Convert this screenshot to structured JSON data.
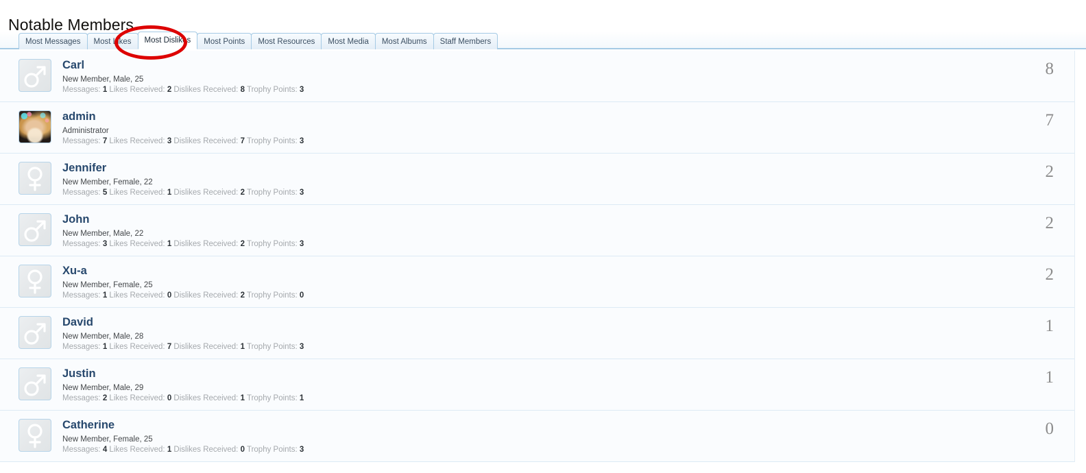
{
  "page": {
    "title": "Notable Members"
  },
  "tabs": [
    {
      "label": "Most Messages",
      "active": false
    },
    {
      "label": "Most Likes",
      "active": false
    },
    {
      "label": "Most Dislikes",
      "active": true
    },
    {
      "label": "Most Points",
      "active": false
    },
    {
      "label": "Most Resources",
      "active": false
    },
    {
      "label": "Most Media",
      "active": false
    },
    {
      "label": "Most Albums",
      "active": false
    },
    {
      "label": "Staff Members",
      "active": false
    }
  ],
  "stat_labels": {
    "messages": "Messages:",
    "likes": "Likes Received:",
    "dislikes": "Dislikes Received:",
    "trophy": "Trophy Points:"
  },
  "members": [
    {
      "name": "Carl",
      "avatar": "male-symbol-avatar",
      "meta": "New Member, Male, 25",
      "messages": "1",
      "likes": "2",
      "dislikes": "8",
      "trophy": "3",
      "count": "8"
    },
    {
      "name": "admin",
      "avatar": "photo-avatar",
      "meta": "Administrator",
      "messages": "7",
      "likes": "3",
      "dislikes": "7",
      "trophy": "3",
      "count": "7"
    },
    {
      "name": "Jennifer",
      "avatar": "female-symbol-avatar",
      "meta": "New Member, Female, 22",
      "messages": "5",
      "likes": "1",
      "dislikes": "2",
      "trophy": "3",
      "count": "2"
    },
    {
      "name": "John",
      "avatar": "male-symbol-avatar",
      "meta": "New Member, Male, 22",
      "messages": "3",
      "likes": "1",
      "dislikes": "2",
      "trophy": "3",
      "count": "2"
    },
    {
      "name": "Xu-a",
      "avatar": "female-symbol-avatar",
      "meta": "New Member, Female, 25",
      "messages": "1",
      "likes": "0",
      "dislikes": "2",
      "trophy": "0",
      "count": "2"
    },
    {
      "name": "David",
      "avatar": "male-symbol-avatar",
      "meta": "New Member, Male, 28",
      "messages": "1",
      "likes": "7",
      "dislikes": "1",
      "trophy": "3",
      "count": "1"
    },
    {
      "name": "Justin",
      "avatar": "male-symbol-avatar",
      "meta": "New Member, Male, 29",
      "messages": "2",
      "likes": "0",
      "dislikes": "1",
      "trophy": "1",
      "count": "1"
    },
    {
      "name": "Catherine",
      "avatar": "female-symbol-avatar",
      "meta": "New Member, Female, 25",
      "messages": "4",
      "likes": "1",
      "dislikes": "0",
      "trophy": "3",
      "count": "0"
    }
  ],
  "annotation": {
    "type": "red-ellipse-highlight",
    "target": "Most Dislikes",
    "color": "#dd0000"
  },
  "colors": {
    "tab_border": "#a5cae4",
    "username": "#27486d",
    "row_bg": "#fafcfe",
    "row_separator": "#dceaf5",
    "count_text": "#8c8c8c",
    "annotation": "#dd0000"
  }
}
